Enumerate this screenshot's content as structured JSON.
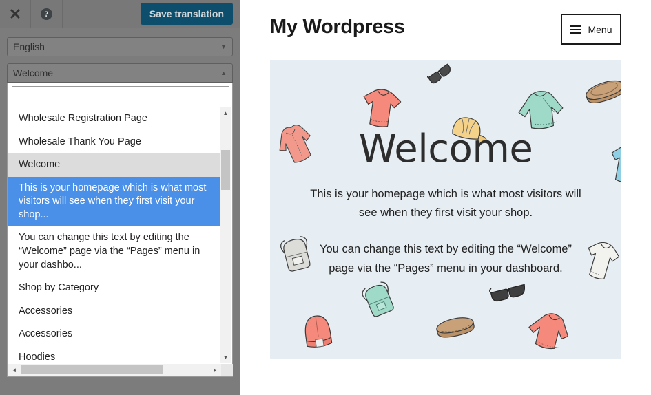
{
  "toolbar": {
    "close_icon": "close-icon",
    "help_icon": "help-icon",
    "help_glyph": "?",
    "close_glyph": "✕",
    "save_label": "Save translation",
    "save_bg": "#0d4e6c"
  },
  "panel": {
    "language_select": {
      "value": "English",
      "caret": "▼"
    },
    "string_select": {
      "value": "Welcome",
      "caret": "▲"
    },
    "search": {
      "value": "",
      "placeholder": ""
    },
    "dropdown_items": [
      {
        "label": "Wholesale Registration Page",
        "state": "normal"
      },
      {
        "label": "Wholesale Thank You Page",
        "state": "normal"
      },
      {
        "label": "Welcome",
        "state": "hovered"
      },
      {
        "label": "This is your homepage which is what most visitors will see when they first visit your shop...",
        "state": "selected"
      },
      {
        "label": "You can change this text by editing the “Welcome” page via the “Pages” menu in your dashbo...",
        "state": "normal"
      },
      {
        "label": "Shop by Category",
        "state": "normal"
      },
      {
        "label": "Accessories",
        "state": "normal"
      },
      {
        "label": "Accessories",
        "state": "normal"
      },
      {
        "label": "Hoodies",
        "state": "normal"
      }
    ],
    "scrollbars": {
      "up_arrow": "▲",
      "down_arrow": "▼",
      "left_arrow": "◄",
      "right_arrow": "►"
    },
    "selected_color": "#4a90e8",
    "hover_color": "#dcdcdc"
  },
  "site": {
    "title": "My Wordpress",
    "menu_label": "Menu",
    "hero": {
      "heading": "Welcome",
      "paragraph1": "This is your homepage which is what most visitors will see when they first visit your shop.",
      "paragraph2": "You can change this text by editing the “Welcome” page via the “Pages” menu in your dashboard.",
      "background": "#e7eef3"
    },
    "decorations": [
      "sunglasses-illustration",
      "coral-tshirt-illustration",
      "yellow-cap-illustration",
      "mint-sweater-illustration",
      "tan-hat-illustration",
      "coral-jacket-illustration",
      "blue-tshirt-illustration",
      "gray-backpack-illustration",
      "white-tshirt-illustration",
      "mint-backpack-illustration",
      "sunglasses-illustration-2",
      "tan-belt-illustration",
      "coral-sweater-illustration",
      "coral-beanie-illustration"
    ]
  }
}
